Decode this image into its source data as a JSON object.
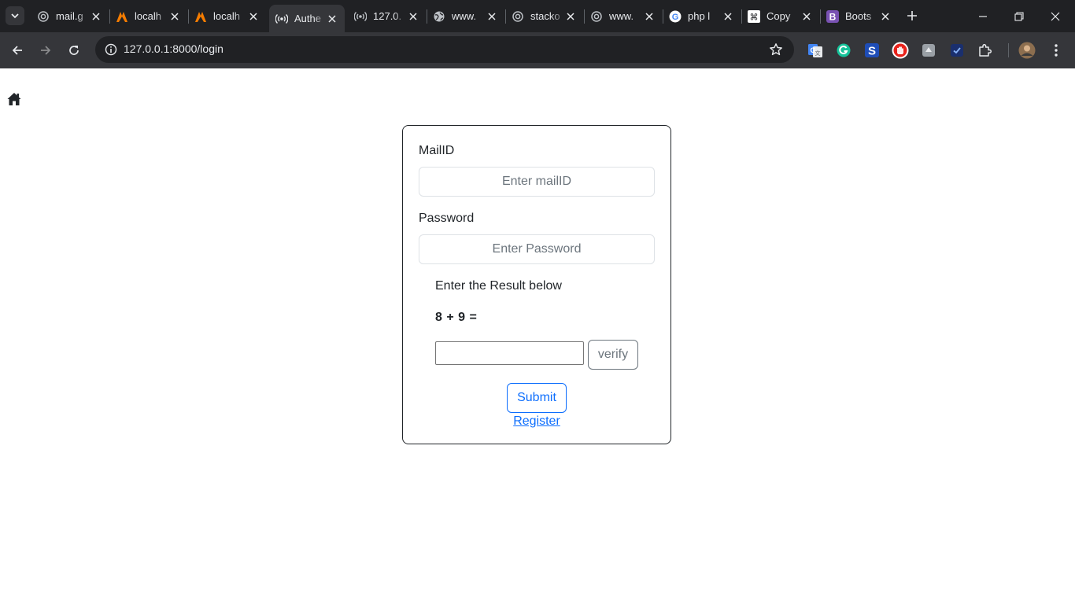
{
  "browser": {
    "tabs": [
      {
        "title": "mail.g",
        "icon": "spiral-icon",
        "active": false
      },
      {
        "title": "localh",
        "icon": "xampp-icon",
        "active": false
      },
      {
        "title": "localh",
        "icon": "xampp-icon",
        "active": false
      },
      {
        "title": "Authe",
        "icon": "radio-signal-icon",
        "active": true
      },
      {
        "title": "127.0.",
        "icon": "radio-signal-icon",
        "active": false
      },
      {
        "title": "www.",
        "icon": "globe-icon",
        "active": false
      },
      {
        "title": "stacko",
        "icon": "spiral-icon",
        "active": false
      },
      {
        "title": "www.",
        "icon": "spiral-icon",
        "active": false
      },
      {
        "title": "php l",
        "icon": "google-icon",
        "active": false
      },
      {
        "title": "Copy",
        "icon": "command-key-icon",
        "active": false
      },
      {
        "title": "Boots",
        "icon": "bootstrap-icon",
        "active": false
      }
    ],
    "url": "127.0.0.1:8000/login",
    "extensions": [
      "google-translate-icon",
      "grammarly-icon",
      "s-extension-icon",
      "adblock-hand-icon",
      "grey-box-extension-icon",
      "blue-check-extension-icon",
      "puzzle-piece-icon"
    ],
    "accent_colors": {
      "tabstrip": "#202124",
      "toolbar": "#35363a",
      "omnibox": "#202124"
    }
  },
  "page": {
    "home_icon": "home-icon",
    "form": {
      "mail_label": "MailID",
      "mail_placeholder": "Enter mailID",
      "password_label": "Password",
      "password_placeholder": "Enter Password",
      "captcha_heading": "Enter the Result below",
      "captcha_equation": "8 + 9 =",
      "captcha_answer": "",
      "verify_label": "verify",
      "submit_label": "Submit",
      "register_label": "Register"
    },
    "colors": {
      "primary": "#0d6efd",
      "secondary": "#6c757d",
      "text": "#212529"
    }
  }
}
